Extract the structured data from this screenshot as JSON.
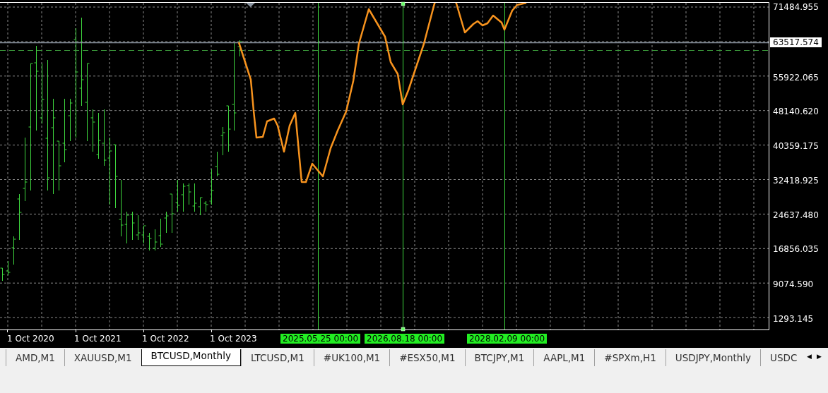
{
  "price_axis": {
    "current_price": "63517.574",
    "labels": [
      "71484.955",
      "55922.065",
      "48140.620",
      "40359.175",
      "32418.925",
      "24637.480",
      "16856.035",
      "9074.590",
      "1293.145"
    ]
  },
  "time_axis": {
    "labels": [
      "1 Oct 2020",
      "1 Oct 2021",
      "1 Oct 2022",
      "1 Oct 2023"
    ]
  },
  "vertical_lines": [
    {
      "label": "2025.05.25 00:00"
    },
    {
      "label": "2026.08.18 00:00"
    },
    {
      "label": "2028.02.09 00:00"
    }
  ],
  "tabs": [
    {
      "label": "AMD,M1",
      "selected": false
    },
    {
      "label": "XAUUSD,M1",
      "selected": false
    },
    {
      "label": "BTCUSD,Monthly",
      "selected": true
    },
    {
      "label": "LTCUSD,M1",
      "selected": false
    },
    {
      "label": "#UK100,M1",
      "selected": false
    },
    {
      "label": "#ESX50,M1",
      "selected": false
    },
    {
      "label": "BTCJPY,M1",
      "selected": false
    },
    {
      "label": "AAPL,M1",
      "selected": false
    },
    {
      "label": "#SPXm,H1",
      "selected": false
    },
    {
      "label": "USDJPY,Monthly",
      "selected": false
    },
    {
      "label": "USDC",
      "selected": false
    }
  ],
  "tab_scroll": {
    "left": "◀",
    "right": "▶"
  }
}
